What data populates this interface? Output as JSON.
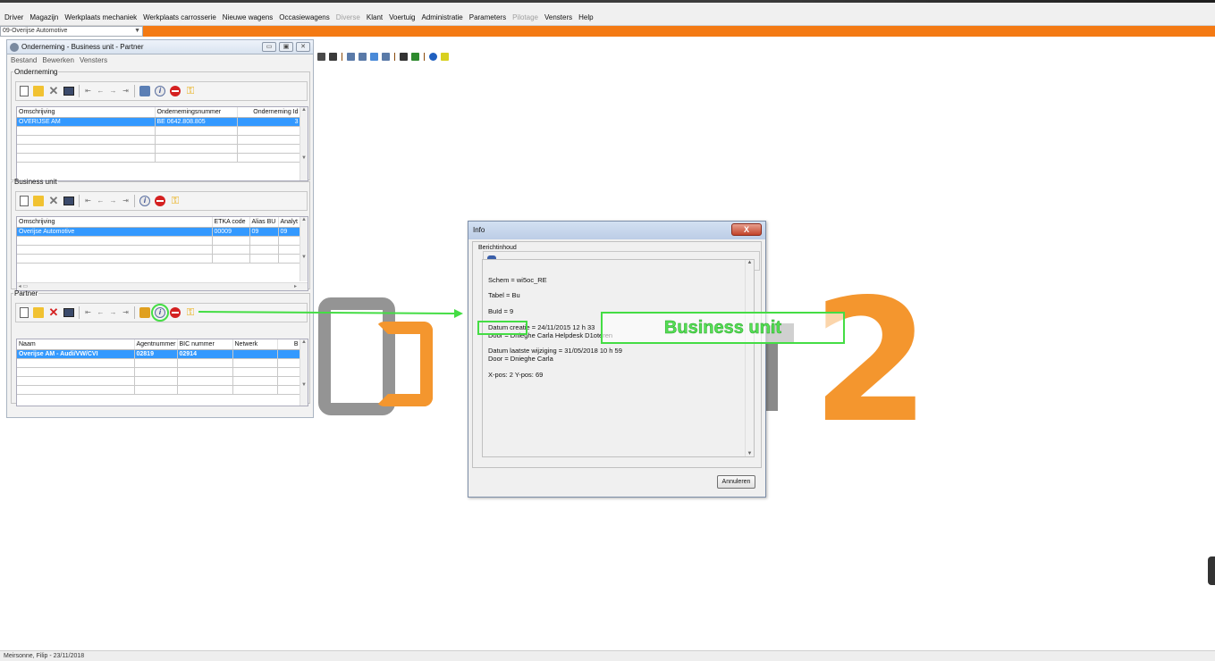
{
  "menu": {
    "items": [
      {
        "label": "Driver",
        "disabled": false
      },
      {
        "label": "Magazijn",
        "disabled": false
      },
      {
        "label": "Werkplaats mechaniek",
        "disabled": false
      },
      {
        "label": "Werkplaats carrosserie",
        "disabled": false
      },
      {
        "label": "Nieuwe wagens",
        "disabled": false
      },
      {
        "label": "Occasiewagens",
        "disabled": false
      },
      {
        "label": "Diverse",
        "disabled": true
      },
      {
        "label": "Klant",
        "disabled": false
      },
      {
        "label": "Voertuig",
        "disabled": false
      },
      {
        "label": "Administratie",
        "disabled": false
      },
      {
        "label": "Parameters",
        "disabled": false
      },
      {
        "label": "Pilotage",
        "disabled": true
      },
      {
        "label": "Vensters",
        "disabled": false
      },
      {
        "label": "Help",
        "disabled": false
      }
    ],
    "company_select": "09-Overijse Automotive"
  },
  "colors": {
    "accent_orange": "#f47a13",
    "selection_blue": "#3399ff",
    "callout_green": "#44dd44",
    "logo_orange": "#f4962e",
    "logo_grey": "#8e8e8e"
  },
  "main_window": {
    "title": "Onderneming - Business unit - Partner",
    "menu": [
      "Bestand",
      "Bewerken",
      "Vensters"
    ],
    "onderneming": {
      "legend": "Onderneming",
      "columns": [
        "Omschrijving",
        "Ondernemingsnummer",
        "Onderneming Id"
      ],
      "rows": [
        [
          "OVERIJSE AM",
          "BE 0642.808.805",
          "3"
        ]
      ]
    },
    "business_unit": {
      "legend": "Business unit",
      "columns": [
        "Omschrijving",
        "ETKA code",
        "Alias BU",
        "Analyt"
      ],
      "rows": [
        [
          "Overijse Automotive",
          "00009",
          "09",
          "09"
        ]
      ]
    },
    "partner": {
      "legend": "Partner",
      "columns": [
        "Naam",
        "Agentnummer",
        "BIC nummer",
        "Netwerk",
        "B"
      ],
      "rows": [
        [
          "Overijse AM - Audi/VW/CVI",
          "02819",
          "02914",
          "",
          ""
        ]
      ]
    }
  },
  "info_dialog": {
    "title": "Info",
    "close_label": "X",
    "group_label": "Berichtinhoud",
    "lines": [
      "Schem = wi5oc_RE",
      "Tabel = Bu",
      "BuId = 9",
      "Datum creatie = 24/11/2015 12 h 33",
      "Door = Dnieghe Carla Helpdesk D1oteren",
      "Datum laatste wijziging = 31/05/2018 10 h 59",
      "Door = Dnieghe Carla",
      "X-pos: 2  Y-pos: 69"
    ],
    "cancel_label": "Annuleren"
  },
  "callout": {
    "label": "Business unit"
  },
  "status": {
    "text": "Meirsonne, Filip - 23/11/2018"
  }
}
